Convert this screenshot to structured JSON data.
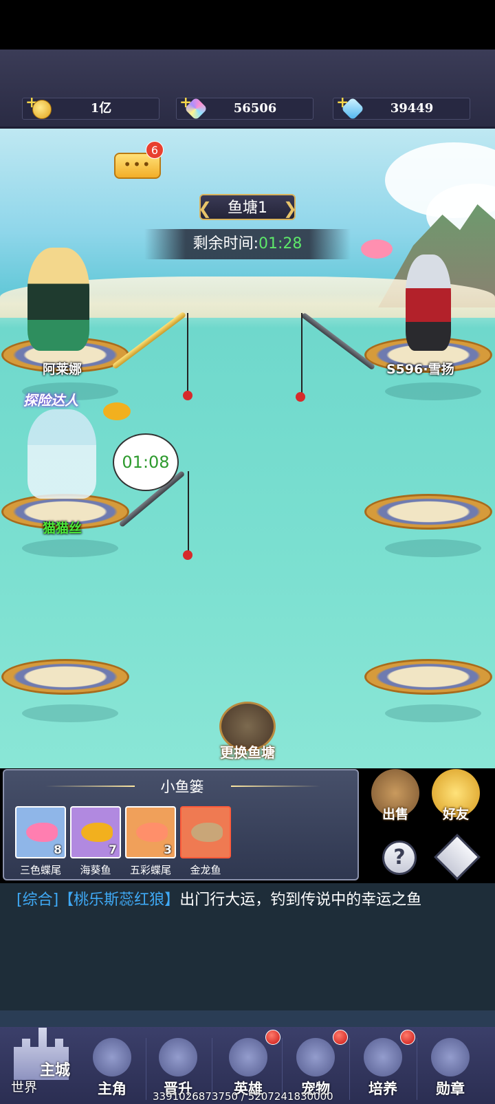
{
  "resources": [
    {
      "icon": "gold-coin-icon",
      "value": "1亿"
    },
    {
      "icon": "rainbow-gem-icon",
      "value": "56506"
    },
    {
      "icon": "blue-diamond-icon",
      "value": "39449"
    }
  ],
  "chat_badge": "6",
  "pond": {
    "name": "鱼塘1",
    "timer_label": "剩余时间:",
    "timer_value": "01:28"
  },
  "players": [
    {
      "name": "阿莱娜"
    },
    {
      "name": "S596·雪扬"
    },
    {
      "name": "猫猫丝",
      "bubble": "01:08",
      "banner": "探险达人"
    }
  ],
  "change_pond_label": "更换鱼塘",
  "basket": {
    "title": "小鱼篓",
    "fish": [
      {
        "name": "三色蝶尾",
        "count": "8",
        "color": "#ff7eb0",
        "bg": "#8fb6e8"
      },
      {
        "name": "海葵鱼",
        "count": "7",
        "color": "#f2b01e",
        "bg": "#b189e0"
      },
      {
        "name": "五彩蝶尾",
        "count": "3",
        "color": "#ff8f6a",
        "bg": "#f0a05a"
      },
      {
        "name": "金龙鱼",
        "count": "",
        "color": "#c9a678",
        "bg": "#ef7a52"
      }
    ]
  },
  "side_buttons": {
    "sell": "出售",
    "friends": "好友",
    "help": "?"
  },
  "chat": {
    "category": "[综合]",
    "sender": "【桃乐斯蕊红狼】",
    "message": "出门行大运，钓到传说中的幸运之鱼"
  },
  "nav": {
    "world_main": "主城",
    "world_sub": "世界",
    "items": [
      {
        "label": "主角",
        "dot": false
      },
      {
        "label": "晋升",
        "dot": false
      },
      {
        "label": "英雄",
        "dot": true
      },
      {
        "label": "宠物",
        "dot": true
      },
      {
        "label": "培养",
        "dot": true
      },
      {
        "label": "勋章",
        "dot": false
      }
    ]
  },
  "footer_numbers": "3391026873750 / 5207241830000",
  "colors": {
    "timer_green": "#5ee86a",
    "chat_blue": "#3fa9f5",
    "name_green": "#4cea39"
  }
}
